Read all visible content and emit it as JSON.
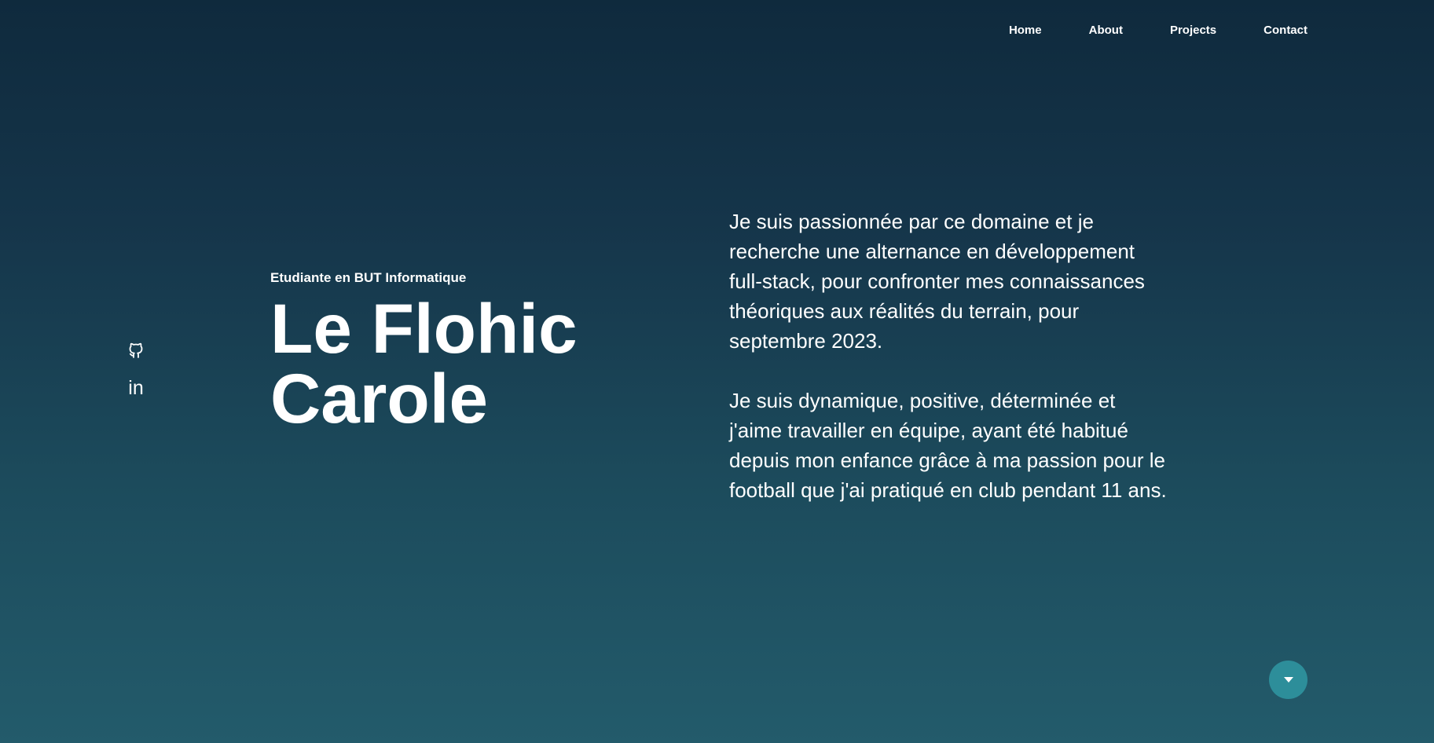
{
  "nav": {
    "items": [
      {
        "label": "Home"
      },
      {
        "label": "About"
      },
      {
        "label": "Projects"
      },
      {
        "label": "Contact"
      }
    ]
  },
  "socials": {
    "github_icon": "github-icon",
    "linkedin_label": "in"
  },
  "hero": {
    "subtitle": "Etudiante en BUT Informatique",
    "name_line1": "Le Flohic",
    "name_line2": "Carole"
  },
  "about": {
    "paragraphs": [
      "Je suis passionnée par ce domaine et je recherche une alternance en développement full-stack, pour confronter mes connaissances théoriques aux réalités du terrain, pour septembre 2023.",
      "Je suis dynamique, positive, déterminée et j'aime travailler en équipe, ayant été habitué depuis mon enfance grâce à ma passion pour le football que j'ai pratiqué en club pendant 11 ans."
    ]
  },
  "scroll_button": {
    "icon": "caret-down-icon"
  },
  "colors": {
    "bg_top": "#0f2a3d",
    "bg_bottom": "#235b6b",
    "accent": "#2d8e9a",
    "text": "#ffffff"
  }
}
